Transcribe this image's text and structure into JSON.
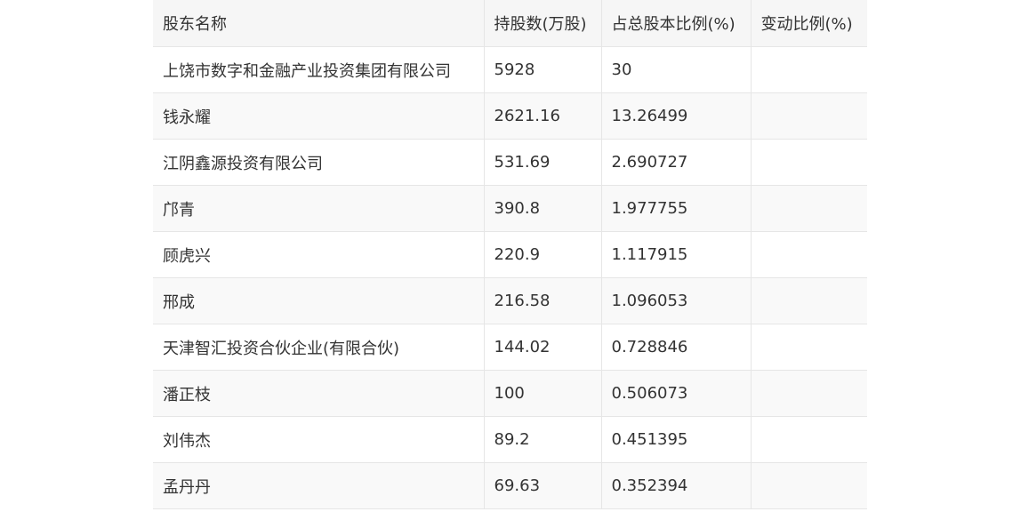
{
  "table": {
    "headers": [
      "股东名称",
      "持股数(万股)",
      "占总股本比例(%)",
      "变动比例(%)"
    ],
    "rows": [
      [
        "上饶市数字和金融产业投资集团有限公司",
        "5928",
        "30",
        ""
      ],
      [
        "钱永耀",
        "2621.16",
        "13.26499",
        ""
      ],
      [
        "江阴鑫源投资有限公司",
        "531.69",
        "2.690727",
        ""
      ],
      [
        "邝青",
        "390.8",
        "1.977755",
        ""
      ],
      [
        "顾虎兴",
        "220.9",
        "1.117915",
        ""
      ],
      [
        "邢成",
        "216.58",
        "1.096053",
        ""
      ],
      [
        "天津智汇投资合伙企业(有限合伙)",
        "144.02",
        "0.728846",
        ""
      ],
      [
        "潘正枝",
        "100",
        "0.506073",
        ""
      ],
      [
        "刘伟杰",
        "89.2",
        "0.451395",
        ""
      ],
      [
        "孟丹丹",
        "69.63",
        "0.352394",
        ""
      ]
    ]
  }
}
